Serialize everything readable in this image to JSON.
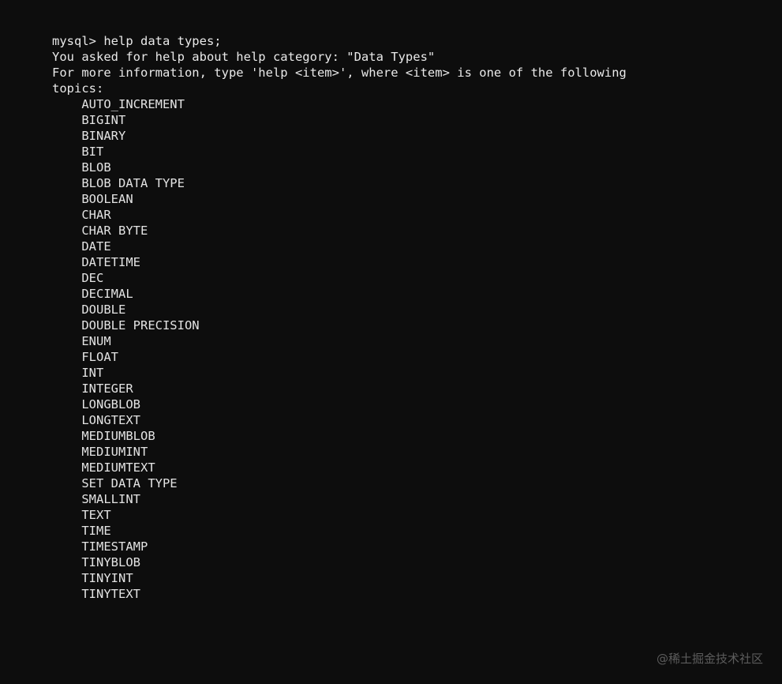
{
  "terminal": {
    "background_color": "#0d0d0d",
    "text_color": "#e6e6e6",
    "prompt_line": "mysql> help data types;",
    "response_lines": [
      "You asked for help about help category: \"Data Types\"",
      "For more information, type 'help <item>', where <item> is one of the following",
      "topics:"
    ],
    "topics": [
      "    AUTO_INCREMENT",
      "    BIGINT",
      "    BINARY",
      "    BIT",
      "    BLOB",
      "    BLOB DATA TYPE",
      "    BOOLEAN",
      "    CHAR",
      "    CHAR BYTE",
      "    DATE",
      "    DATETIME",
      "    DEC",
      "    DECIMAL",
      "    DOUBLE",
      "    DOUBLE PRECISION",
      "    ENUM",
      "    FLOAT",
      "    INT",
      "    INTEGER",
      "    LONGBLOB",
      "    LONGTEXT",
      "    MEDIUMBLOB",
      "    MEDIUMINT",
      "    MEDIUMTEXT",
      "    SET DATA TYPE",
      "    SMALLINT",
      "    TEXT",
      "    TIME",
      "    TIMESTAMP",
      "    TINYBLOB",
      "    TINYINT",
      "    TINYTEXT"
    ]
  },
  "watermark": {
    "text": "@稀土掘金技术社区",
    "color": "#5c5c5c"
  }
}
